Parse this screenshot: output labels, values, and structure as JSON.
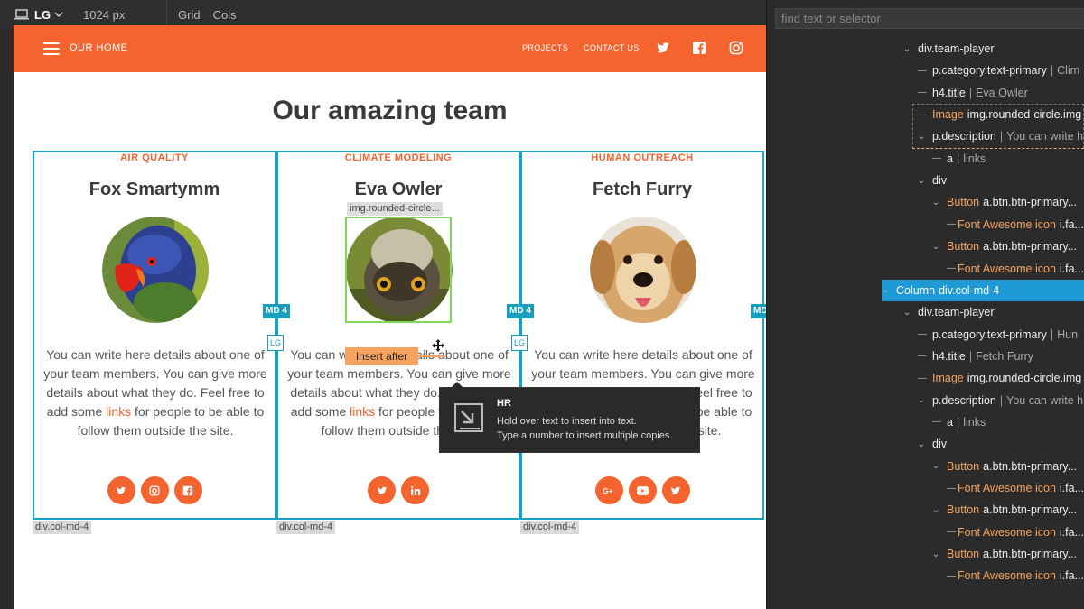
{
  "toolbar": {
    "device": "LG",
    "width_label": "1024 px",
    "grid_label": "Grid",
    "cols_label": "Cols"
  },
  "site": {
    "brand": "OUR HOME",
    "nav_links": [
      "PROJECTS",
      "CONTACT US"
    ],
    "nav_icons": [
      "twitter-icon",
      "facebook-icon",
      "instagram-icon"
    ],
    "heading": "Our amazing team",
    "accent_color": "#f5632e",
    "columns": [
      {
        "category": "AIR QUALITY",
        "name": "Fox Smartymm",
        "desc_before": "You can write here details about one of your team members. You can give more details about what they do. Feel free to add some ",
        "link": "links",
        "desc_after": " for people to be able to follow them outside the site.",
        "buttons": [
          "twitter-icon",
          "instagram-icon",
          "facebook-icon"
        ],
        "label": "div.col-md-4"
      },
      {
        "category": "CLIMATE MODELING",
        "name": "Eva Owler",
        "desc_before": "You can write here details about one of your team members. You can give more details about what they do. Feel free to add some ",
        "link": "links",
        "desc_after": " for people to be able to follow them outside the site.",
        "buttons": [
          "twitter-icon",
          "linkedin-icon"
        ],
        "label": "div.col-md-4"
      },
      {
        "category": "HUMAN OUTREACH",
        "name": "Fetch Furry",
        "desc_before": "You can write here details about one of your team members. You can give more details about what they do. Feel free to add some ",
        "link": "links",
        "desc_after": " for people to be able to follow them outside the site.",
        "buttons": [
          "google-plus-icon",
          "youtube-icon",
          "twitter-icon"
        ],
        "label": "div.col-md-4"
      }
    ]
  },
  "editor": {
    "md_badge": "MD 4",
    "lg_badge": "LG",
    "img_label": "img.rounded-circle...",
    "insert_after": "Insert after",
    "tooltip": {
      "title": "HR",
      "line1": "Hold over text to insert into text.",
      "line2": "Type a number to insert multiple copies."
    }
  },
  "panel": {
    "search_placeholder": "find text or selector",
    "tree": [
      {
        "el": "div.team-player",
        "text": ""
      },
      {
        "el": "p.category.text-primary",
        "text": "Clim"
      },
      {
        "el": "h4.title",
        "text": "Eva Owler"
      },
      {
        "type": "Image",
        "el": "img.rounded-circle.img",
        "text": ""
      },
      {
        "el": "p.description",
        "text": "You can write h"
      },
      {
        "el": "a",
        "text": "links"
      },
      {
        "el": "div",
        "text": ""
      },
      {
        "type": "Button",
        "el": "a.btn.btn-primary...",
        "text": ""
      },
      {
        "type": "Font Awesome icon",
        "el": "i.fa...",
        "text": ""
      },
      {
        "type": "Button",
        "el": "a.btn.btn-primary...",
        "text": ""
      },
      {
        "type": "Font Awesome icon",
        "el": "i.fa...",
        "text": ""
      },
      {
        "type": "Column",
        "el": "div.col-md-4",
        "text": ""
      },
      {
        "el": "div.team-player",
        "text": ""
      },
      {
        "el": "p.category.text-primary",
        "text": "Hun"
      },
      {
        "el": "h4.title",
        "text": "Fetch Furry"
      },
      {
        "type": "Image",
        "el": "img.rounded-circle.img",
        "text": ""
      },
      {
        "el": "p.description",
        "text": "You can write h"
      },
      {
        "el": "a",
        "text": "links"
      },
      {
        "el": "div",
        "text": ""
      },
      {
        "type": "Button",
        "el": "a.btn.btn-primary...",
        "text": ""
      },
      {
        "type": "Font Awesome icon",
        "el": "i.fa...",
        "text": ""
      },
      {
        "type": "Button",
        "el": "a.btn.btn-primary...",
        "text": ""
      },
      {
        "type": "Font Awesome icon",
        "el": "i.fa...",
        "text": ""
      },
      {
        "type": "Button",
        "el": "a.btn.btn-primary...",
        "text": ""
      },
      {
        "type": "Font Awesome icon",
        "el": "i.fa...",
        "text": ""
      }
    ]
  }
}
